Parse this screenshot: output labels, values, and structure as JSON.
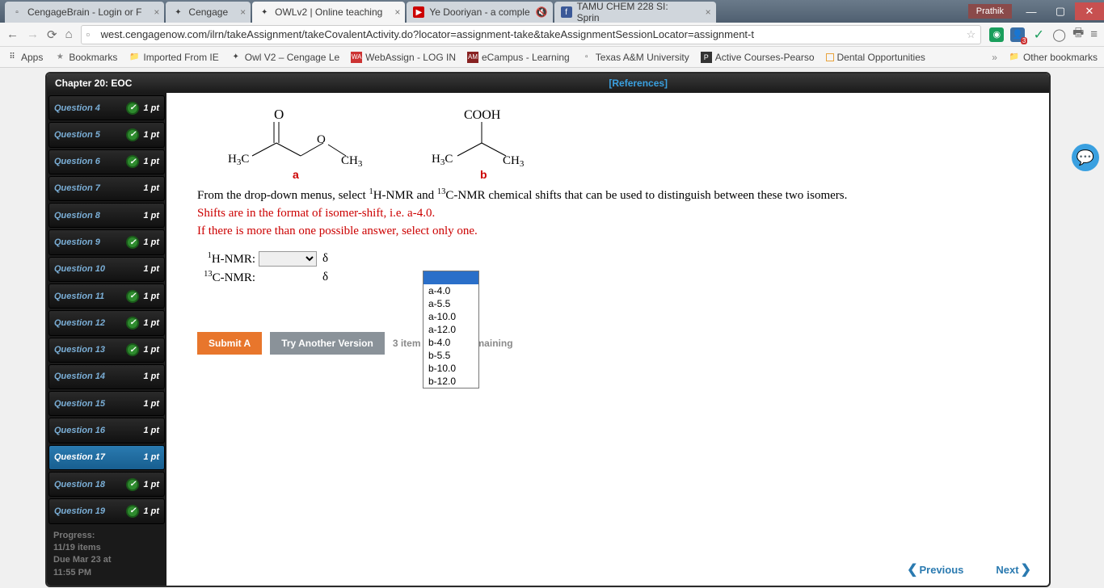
{
  "browser": {
    "tabs": [
      {
        "label": "CengageBrain - Login or F",
        "icon": "▫"
      },
      {
        "label": "Cengage",
        "icon": "✦"
      },
      {
        "label": "OWLv2 | Online teaching",
        "icon": "✦",
        "active": true
      },
      {
        "label": "Ye Dooriyan - a comple",
        "icon": "▶"
      },
      {
        "label": "TAMU CHEM 228 SI: Sprin",
        "icon": "f"
      }
    ],
    "user": "Prathik",
    "url": "west.cengagenow.com/ilrn/takeAssignment/takeCovalentActivity.do?locator=assignment-take&takeAssignmentSessionLocator=assignment-t",
    "bookmarks": [
      {
        "label": "Apps",
        "icon": "⠿",
        "color": "#e06"
      },
      {
        "label": "Bookmarks",
        "icon": "★",
        "color": "#888"
      },
      {
        "label": "Imported From IE",
        "icon": "📁",
        "color": "#e8a33d"
      },
      {
        "label": "Owl V2 – Cengage Le",
        "icon": "✦",
        "color": "#6ac"
      },
      {
        "label": "WebAssign - LOG IN",
        "icon": "WA",
        "color": "#c33"
      },
      {
        "label": "eCampus - Learning",
        "icon": "A",
        "color": "#822"
      },
      {
        "label": "Texas A&M University",
        "icon": "▫",
        "color": "#888"
      },
      {
        "label": "Active Courses-Pearso",
        "icon": "P",
        "color": "#333"
      },
      {
        "label": "Dental Opportunities",
        "icon": "▫",
        "color": "#e8a33d"
      }
    ],
    "other_bookmarks": "Other bookmarks"
  },
  "assignment": {
    "chapter": "Chapter 20: EOC",
    "references": "[References]",
    "questions": [
      {
        "label": "Question 4",
        "pts": "1 pt",
        "checked": true
      },
      {
        "label": "Question 5",
        "pts": "1 pt",
        "checked": true
      },
      {
        "label": "Question 6",
        "pts": "1 pt",
        "checked": true
      },
      {
        "label": "Question 7",
        "pts": "1 pt",
        "checked": false
      },
      {
        "label": "Question 8",
        "pts": "1 pt",
        "checked": false
      },
      {
        "label": "Question 9",
        "pts": "1 pt",
        "checked": true
      },
      {
        "label": "Question 10",
        "pts": "1 pt",
        "checked": false
      },
      {
        "label": "Question 11",
        "pts": "1 pt",
        "checked": true
      },
      {
        "label": "Question 12",
        "pts": "1 pt",
        "checked": true
      },
      {
        "label": "Question 13",
        "pts": "1 pt",
        "checked": true
      },
      {
        "label": "Question 14",
        "pts": "1 pt",
        "checked": false
      },
      {
        "label": "Question 15",
        "pts": "1 pt",
        "checked": false
      },
      {
        "label": "Question 16",
        "pts": "1 pt",
        "checked": false
      },
      {
        "label": "Question 17",
        "pts": "1 pt",
        "checked": false,
        "selected": true
      },
      {
        "label": "Question 18",
        "pts": "1 pt",
        "checked": true
      },
      {
        "label": "Question 19",
        "pts": "1 pt",
        "checked": true
      }
    ],
    "progress_label": "Progress:",
    "progress_value": "11/19 items",
    "due_label": "Due Mar 23 at",
    "due_time": "11:55 PM"
  },
  "problem": {
    "mol_a": {
      "o": "O",
      "h3c": "H₃C",
      "ch3": "CH₃",
      "label": "a"
    },
    "mol_b": {
      "cooh": "COOH",
      "h3c": "H₃C",
      "ch3": "CH₃",
      "label": "b"
    },
    "instruction_black": "From the drop-down menus, select ¹H-NMR and ¹³C-NMR chemical shifts that can be used to distinguish between these two isomers.",
    "instruction_red1": "Shifts are in the format of isomer-shift, i.e. a-4.0.",
    "instruction_red2": "If there is more than one possible answer, select only one.",
    "hnmr_label": "¹H-NMR:",
    "cnmr_label": "¹³C-NMR:",
    "delta": "δ",
    "options": [
      "a-4.0",
      "a-5.5",
      "a-10.0",
      "a-12.0",
      "b-4.0",
      "b-5.5",
      "b-10.0",
      "b-12.0"
    ],
    "submit": "Submit A",
    "try": "Try Another Version",
    "remaining": "3 item attempts remaining",
    "prev": "Previous",
    "next": "Next"
  }
}
